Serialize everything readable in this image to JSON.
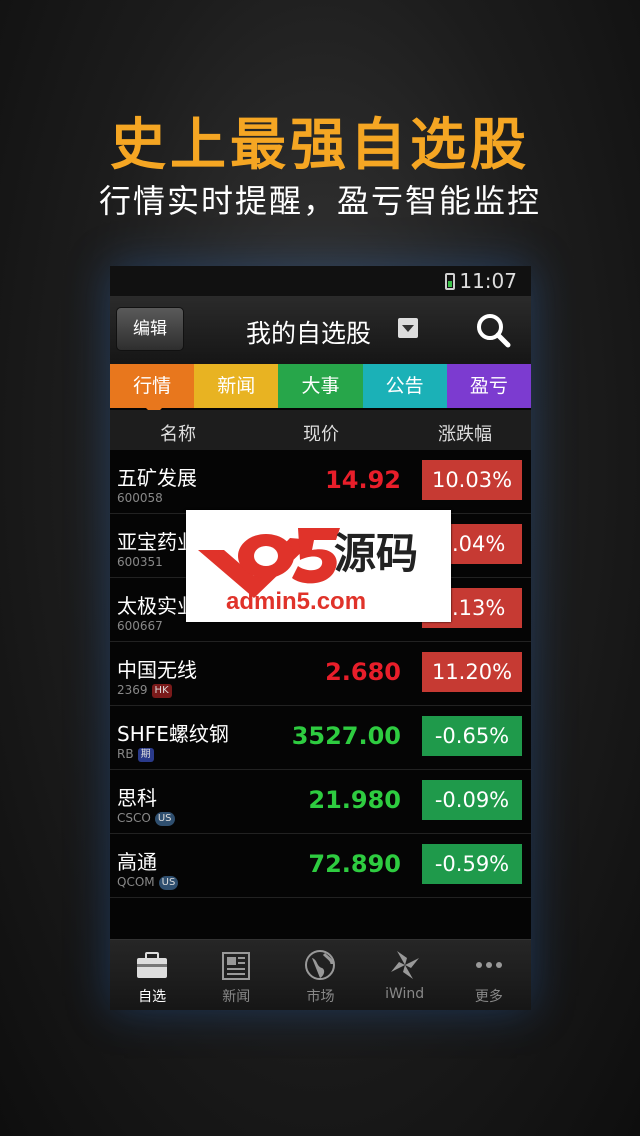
{
  "promo": {
    "title": "史上最强自选股",
    "subtitle": "行情实时提醒，盈亏智能监控"
  },
  "status_bar": {
    "time": "11:07"
  },
  "header": {
    "edit_label": "编辑",
    "title": "我的自选股"
  },
  "tabs": [
    {
      "label": "行情",
      "color": "#e8771d",
      "active": true
    },
    {
      "label": "新闻",
      "color": "#e8b322"
    },
    {
      "label": "大事",
      "color": "#27a64a"
    },
    {
      "label": "公告",
      "color": "#1bb1b7"
    },
    {
      "label": "盈亏",
      "color": "#7c3bd0"
    }
  ],
  "columns": {
    "name": "名称",
    "price": "现价",
    "change": "涨跌幅"
  },
  "stocks": [
    {
      "name": "五矿发展",
      "code": "600058",
      "badge": "",
      "price": "14.92",
      "change": "10.03%",
      "dir": "up"
    },
    {
      "name": "亚宝药业",
      "code": "600351",
      "badge": "",
      "price": "",
      "change": "5.04%",
      "dir": "up"
    },
    {
      "name": "太极实业",
      "code": "600667",
      "badge": "",
      "price": "",
      "change": "6.13%",
      "dir": "up"
    },
    {
      "name": "中国无线",
      "code": "2369",
      "badge": "HK",
      "price": "2.680",
      "change": "11.20%",
      "dir": "up"
    },
    {
      "name": "SHFE螺纹钢",
      "code": "RB",
      "badge": "期",
      "price": "3527.00",
      "change": "-0.65%",
      "dir": "down"
    },
    {
      "name": "思科",
      "code": "CSCO",
      "badge": "US",
      "price": "21.980",
      "change": "-0.09%",
      "dir": "down"
    },
    {
      "name": "高通",
      "code": "QCOM",
      "badge": "US",
      "price": "72.890",
      "change": "-0.59%",
      "dir": "down"
    }
  ],
  "bottom_nav": [
    {
      "label": "自选",
      "icon": "briefcase-icon",
      "active": true
    },
    {
      "label": "新闻",
      "icon": "newspaper-icon"
    },
    {
      "label": "市场",
      "icon": "globe-icon"
    },
    {
      "label": "iWind",
      "icon": "windmill-icon"
    },
    {
      "label": "更多",
      "icon": "more-dots-icon"
    }
  ],
  "watermark": {
    "logo": "a5",
    "title": "源码",
    "url": "admin5.com"
  }
}
